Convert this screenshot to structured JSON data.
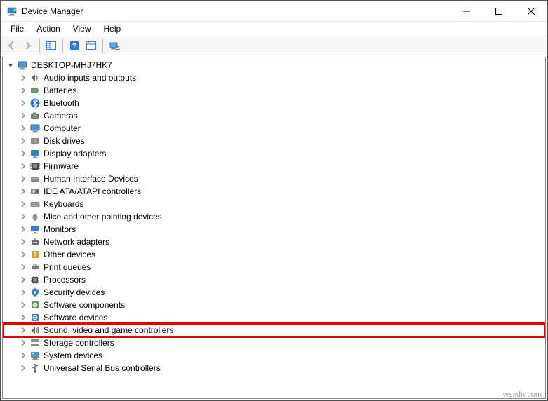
{
  "window": {
    "title": "Device Manager"
  },
  "menubar": {
    "items": [
      "File",
      "Action",
      "View",
      "Help"
    ]
  },
  "tree": {
    "root": {
      "label": "DESKTOP-MHJ7HK7",
      "expanded": true
    },
    "children": [
      {
        "label": "Audio inputs and outputs",
        "icon": "audio-icon",
        "highlight": false
      },
      {
        "label": "Batteries",
        "icon": "battery-icon",
        "highlight": false
      },
      {
        "label": "Bluetooth",
        "icon": "bluetooth-icon",
        "highlight": false
      },
      {
        "label": "Cameras",
        "icon": "camera-icon",
        "highlight": false
      },
      {
        "label": "Computer",
        "icon": "computer-icon",
        "highlight": false
      },
      {
        "label": "Disk drives",
        "icon": "disk-icon",
        "highlight": false
      },
      {
        "label": "Display adapters",
        "icon": "display-icon",
        "highlight": false
      },
      {
        "label": "Firmware",
        "icon": "firmware-icon",
        "highlight": false
      },
      {
        "label": "Human Interface Devices",
        "icon": "hid-icon",
        "highlight": false
      },
      {
        "label": "IDE ATA/ATAPI controllers",
        "icon": "ide-icon",
        "highlight": false
      },
      {
        "label": "Keyboards",
        "icon": "keyboard-icon",
        "highlight": false
      },
      {
        "label": "Mice and other pointing devices",
        "icon": "mouse-icon",
        "highlight": false
      },
      {
        "label": "Monitors",
        "icon": "monitor-icon",
        "highlight": false
      },
      {
        "label": "Network adapters",
        "icon": "network-icon",
        "highlight": false
      },
      {
        "label": "Other devices",
        "icon": "other-icon",
        "highlight": false
      },
      {
        "label": "Print queues",
        "icon": "printer-icon",
        "highlight": false
      },
      {
        "label": "Processors",
        "icon": "cpu-icon",
        "highlight": false
      },
      {
        "label": "Security devices",
        "icon": "security-icon",
        "highlight": false
      },
      {
        "label": "Software components",
        "icon": "software-comp-icon",
        "highlight": false
      },
      {
        "label": "Software devices",
        "icon": "software-dev-icon",
        "highlight": false
      },
      {
        "label": "Sound, video and game controllers",
        "icon": "sound-icon",
        "highlight": true
      },
      {
        "label": "Storage controllers",
        "icon": "storage-icon",
        "highlight": false
      },
      {
        "label": "System devices",
        "icon": "system-icon",
        "highlight": false
      },
      {
        "label": "Universal Serial Bus controllers",
        "icon": "usb-icon",
        "highlight": false
      }
    ]
  },
  "footer": {
    "watermark": "wsxdn.com"
  },
  "colors": {
    "highlight_border": "#e60000"
  }
}
